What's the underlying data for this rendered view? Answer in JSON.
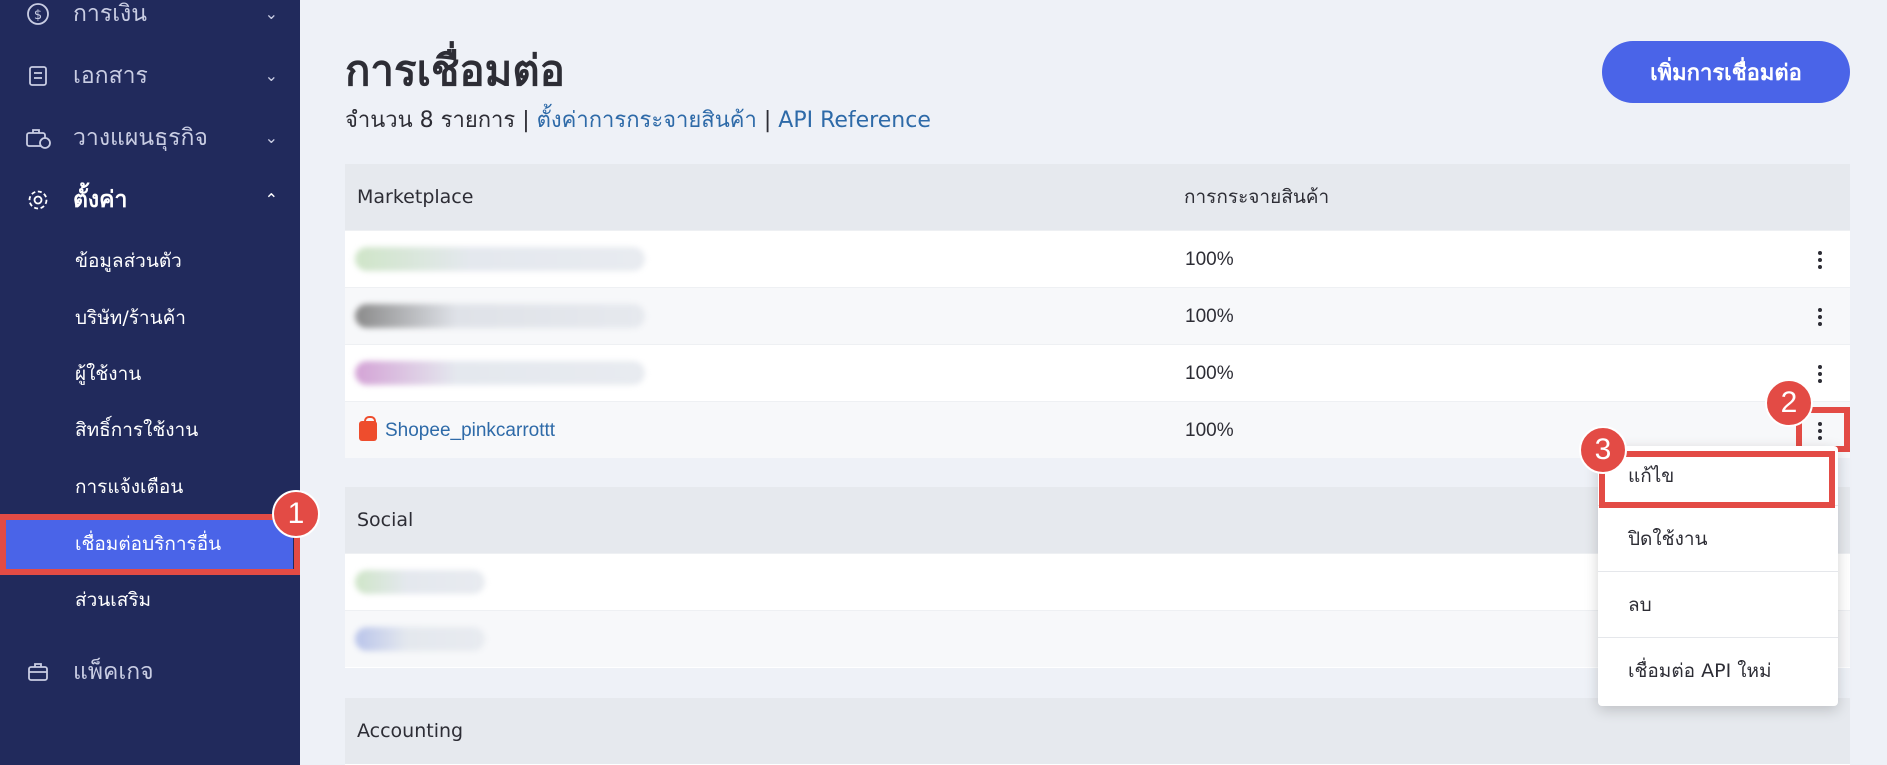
{
  "sidebar": {
    "items": [
      {
        "label": "การเงิน",
        "icon": "dollar-circle-icon",
        "chevron": "⌄"
      },
      {
        "label": "เอกสาร",
        "icon": "document-icon",
        "chevron": "⌄"
      },
      {
        "label": "วางแผนธุรกิจ",
        "icon": "briefcase-clock-icon",
        "chevron": "⌄"
      },
      {
        "label": "ตั้งค่า",
        "icon": "gear-icon",
        "chevron": "⌃"
      },
      {
        "label": "แพ็คเกจ",
        "icon": "package-icon"
      }
    ],
    "sub_items": [
      {
        "label": "ข้อมูลส่วนตัว"
      },
      {
        "label": "บริษัท/ร้านค้า"
      },
      {
        "label": "ผู้ใช้งาน"
      },
      {
        "label": "สิทธิ์การใช้งาน"
      },
      {
        "label": "การแจ้งเตือน"
      },
      {
        "label": "เชื่อมต่อบริการอื่น"
      },
      {
        "label": "ส่วนเสริม"
      }
    ]
  },
  "header": {
    "title": "การเชื่อมต่อ",
    "count_text": "จำนวน 8 รายการ |",
    "link_distribution": "ตั้งค่าการกระจายสินค้า",
    "separator": "|",
    "link_api": "API Reference",
    "add_button": "เพิ่มการเชื่อมต่อ"
  },
  "marketplace": {
    "col_name": "Marketplace",
    "col_distribution": "การกระจายสินค้า",
    "rows": [
      {
        "name": "",
        "distribution": "100%"
      },
      {
        "name": "",
        "distribution": "100%"
      },
      {
        "name": "",
        "distribution": "100%"
      },
      {
        "name": "Shopee_pinkcarrottt",
        "distribution": "100%"
      }
    ]
  },
  "social": {
    "title": "Social"
  },
  "accounting": {
    "title": "Accounting"
  },
  "menu": {
    "items": [
      {
        "label": "แก้ไข"
      },
      {
        "label": "ปิดใช้งาน"
      },
      {
        "label": "ลบ"
      },
      {
        "label": "เชื่อมต่อ API ใหม่"
      }
    ]
  },
  "annotations": {
    "badge1": "1",
    "badge2": "2",
    "badge3": "3"
  },
  "colors": {
    "sidebar_bg": "#212a5c",
    "accent": "#4a64e8",
    "highlight": "#e34b45",
    "link": "#2e6aa8"
  }
}
